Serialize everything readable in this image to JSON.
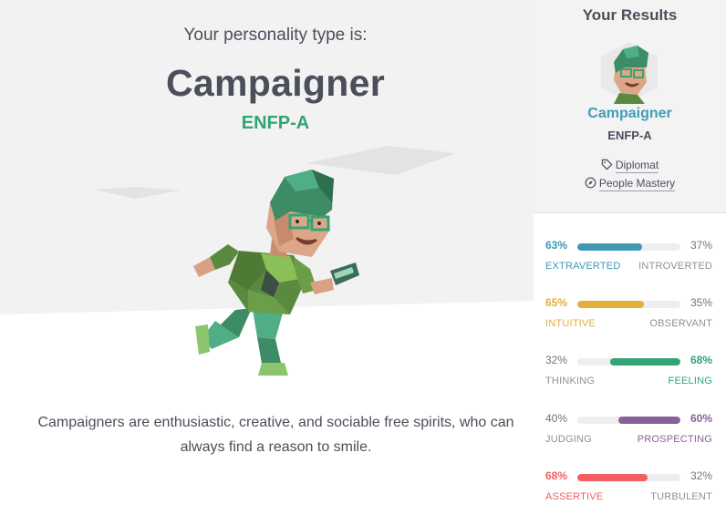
{
  "main": {
    "intro": "Your personality type is:",
    "type_name": "Campaigner",
    "type_code": "ENFP-A",
    "description": "Campaigners are enthusiastic, creative, and sociable free spirits, who can always find a reason to smile."
  },
  "sidebar": {
    "title": "Your Results",
    "type_name": "Campaigner",
    "type_code": "ENFP-A",
    "role_tag": {
      "icon": "tag-icon",
      "label": "Diplomat"
    },
    "strategy_tag": {
      "icon": "compass-icon",
      "label": "People Mastery"
    },
    "traits": [
      {
        "left_pct": "63%",
        "right_pct": "37%",
        "left_label": "EXTRAVERTED",
        "right_label": "INTROVERTED",
        "dominant": "left",
        "value": 63,
        "color": "#4298b4"
      },
      {
        "left_pct": "65%",
        "right_pct": "35%",
        "left_label": "INTUITIVE",
        "right_label": "OBSERVANT",
        "dominant": "left",
        "value": 65,
        "color": "#e4ae3a"
      },
      {
        "left_pct": "32%",
        "right_pct": "68%",
        "left_label": "THINKING",
        "right_label": "FEELING",
        "dominant": "right",
        "value": 68,
        "color": "#33a474"
      },
      {
        "left_pct": "40%",
        "right_pct": "60%",
        "left_label": "JUDGING",
        "right_label": "PROSPECTING",
        "dominant": "right",
        "value": 60,
        "color": "#88619a"
      },
      {
        "left_pct": "68%",
        "right_pct": "32%",
        "left_label": "ASSERTIVE",
        "right_label": "TURBULENT",
        "dominant": "left",
        "value": 68,
        "color": "#f25e62"
      }
    ]
  }
}
